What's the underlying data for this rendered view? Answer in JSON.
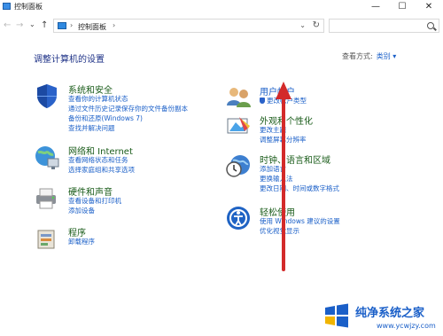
{
  "window": {
    "title": "控制面板",
    "controls": [
      "—",
      "☐",
      "✕"
    ]
  },
  "nav": {
    "back": "←",
    "forward": "→",
    "dropdown": "⌄",
    "up": "↑"
  },
  "address": {
    "separator1": "›",
    "path": "控制面板",
    "separator2": "›",
    "dropdown": "⌄",
    "refresh": "↻"
  },
  "search": {
    "placeholder": ""
  },
  "heading": "调整计算机的设置",
  "view_by": {
    "label": "查看方式:",
    "value": "类别 ▾"
  },
  "left_categories": [
    {
      "title": "系统和安全",
      "icon": "shield-icon",
      "links": [
        "查看你的计算机状态",
        "通过文件历史记录保存你的文件备份副本",
        "备份和还原(Windows 7)",
        "查找并解决问题"
      ]
    },
    {
      "title": "网络和 Internet",
      "icon": "network-icon",
      "links": [
        "查看网络状态和任务",
        "选择家庭组和共享选项"
      ]
    },
    {
      "title": "硬件和声音",
      "icon": "printer-icon",
      "links": [
        "查看设备和打印机",
        "添加设备"
      ]
    },
    {
      "title": "程序",
      "icon": "programs-icon",
      "links": [
        "卸载程序"
      ]
    }
  ],
  "right_categories": [
    {
      "title": "用户帐户",
      "icon": "users-icon",
      "links": [
        "更改帐户类型"
      ]
    },
    {
      "title": "外观和个性化",
      "icon": "appearance-icon",
      "links": [
        "更改主题",
        "调整屏幕分辨率"
      ]
    },
    {
      "title": "时钟、语言和区域",
      "icon": "clock-globe-icon",
      "links": [
        "添加语言",
        "更换输入法",
        "更改日期、时间或数字格式"
      ]
    },
    {
      "title": "轻松使用",
      "icon": "ease-of-access-icon",
      "links": [
        "使用 Windows 建议的设置",
        "优化视觉显示"
      ]
    }
  ],
  "watermark": {
    "text": "纯净系统之家",
    "url": "www.ycwjzy.com"
  },
  "colors": {
    "link": "#1a5fc8",
    "category_title": "#1a5c1a",
    "heading": "#1e3287",
    "arrow": "#d32a2a"
  }
}
